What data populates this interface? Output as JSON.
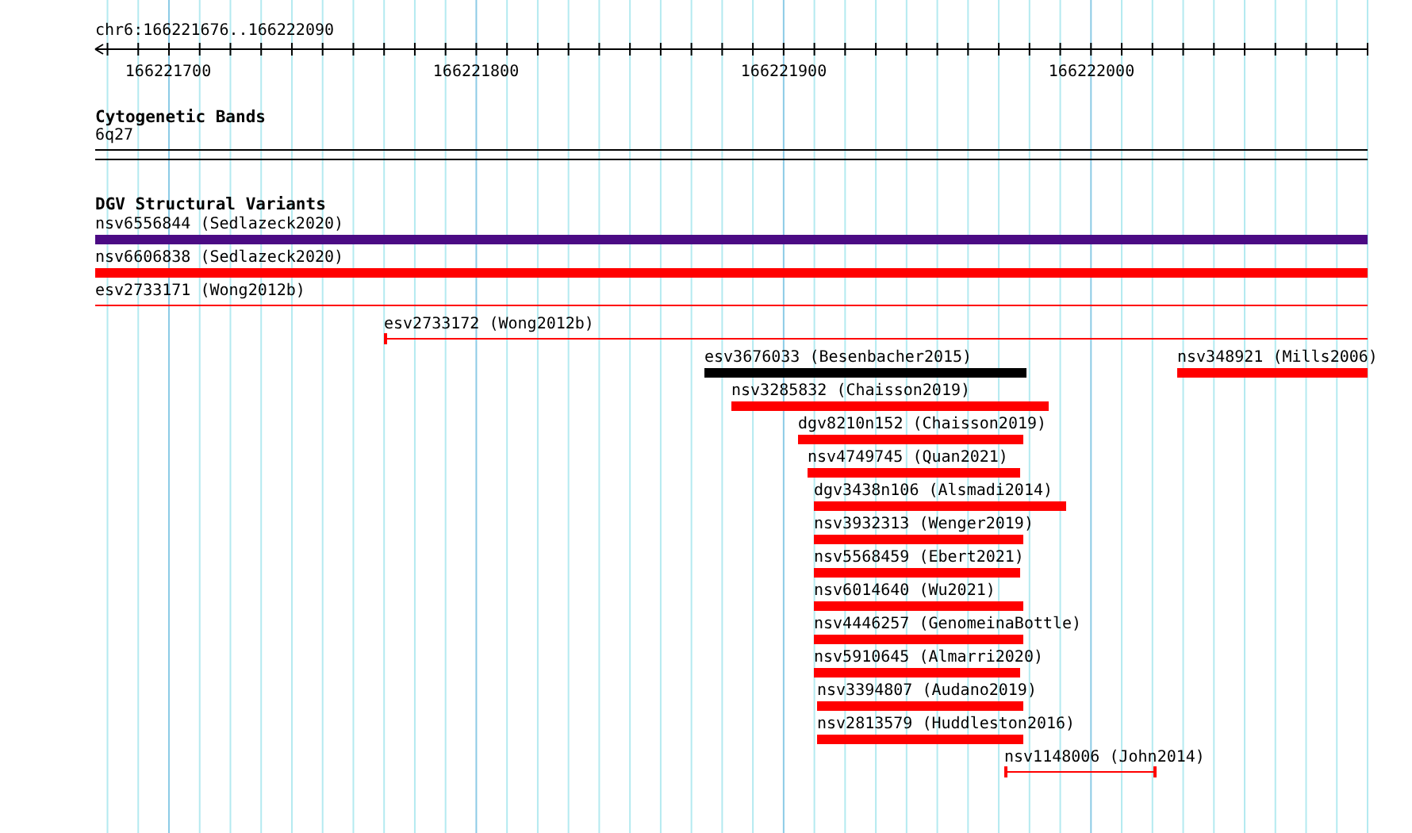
{
  "ruler": {
    "range_label": "chr6:166221676..166222090",
    "ticks": [
      "166221700",
      "166221800",
      "166221900",
      "166222000"
    ]
  },
  "tracks": [
    {
      "title": "Cytogenetic Bands",
      "kind": "bands",
      "band_label": "6q27"
    },
    {
      "title": "DGV Structural Variants",
      "kind": "variants",
      "rows": [
        {
          "features": [
            {
              "label": "nsv6556844 (Sedlazeck2020)",
              "kind": "thick",
              "color": "#4b0b84"
            }
          ]
        },
        {
          "features": [
            {
              "label": "nsv6606838 (Sedlazeck2020)",
              "kind": "thick",
              "color": "#ff0000"
            }
          ]
        },
        {
          "features": [
            {
              "label": "esv2733171 (Wong2012b)",
              "kind": "thin",
              "color": "#ff0000"
            }
          ]
        },
        {
          "features": [
            {
              "label": "esv2733172 (Wong2012b)",
              "kind": "thin",
              "color": "#ff0000"
            }
          ]
        },
        {
          "features": [
            {
              "label": "esv3676033 (Besenbacher2015)",
              "kind": "thick",
              "color": "#000000"
            },
            {
              "label": "nsv348921 (Mills2006)",
              "kind": "thick",
              "color": "#ff0000"
            }
          ]
        },
        {
          "features": [
            {
              "label": "nsv3285832 (Chaisson2019)",
              "kind": "thick",
              "color": "#ff0000"
            }
          ]
        },
        {
          "features": [
            {
              "label": "dgv8210n152 (Chaisson2019)",
              "kind": "thick",
              "color": "#ff0000"
            }
          ]
        },
        {
          "features": [
            {
              "label": "nsv4749745 (Quan2021)",
              "kind": "thick",
              "color": "#ff0000"
            }
          ]
        },
        {
          "features": [
            {
              "label": "dgv3438n106 (Alsmadi2014)",
              "kind": "thick",
              "color": "#ff0000"
            }
          ]
        },
        {
          "features": [
            {
              "label": "nsv3932313 (Wenger2019)",
              "kind": "thick",
              "color": "#ff0000"
            }
          ]
        },
        {
          "features": [
            {
              "label": "nsv5568459 (Ebert2021)",
              "kind": "thick",
              "color": "#ff0000"
            }
          ]
        },
        {
          "features": [
            {
              "label": "nsv6014640 (Wu2021)",
              "kind": "thick",
              "color": "#ff0000"
            }
          ]
        },
        {
          "features": [
            {
              "label": "nsv4446257 (GenomeinaBottle)",
              "kind": "thick",
              "color": "#ff0000"
            }
          ]
        },
        {
          "features": [
            {
              "label": "nsv5910645 (Almarri2020)",
              "kind": "thick",
              "color": "#ff0000"
            }
          ]
        },
        {
          "features": [
            {
              "label": "nsv3394807 (Audano2019)",
              "kind": "thick",
              "color": "#ff0000"
            }
          ]
        },
        {
          "features": [
            {
              "label": "nsv2813579 (Huddleston2016)",
              "kind": "thick",
              "color": "#ff0000"
            }
          ]
        },
        {
          "features": [
            {
              "label": "nsv1148006 (John2014)",
              "kind": "thin",
              "color": "#ff0000"
            }
          ]
        }
      ]
    }
  ]
}
